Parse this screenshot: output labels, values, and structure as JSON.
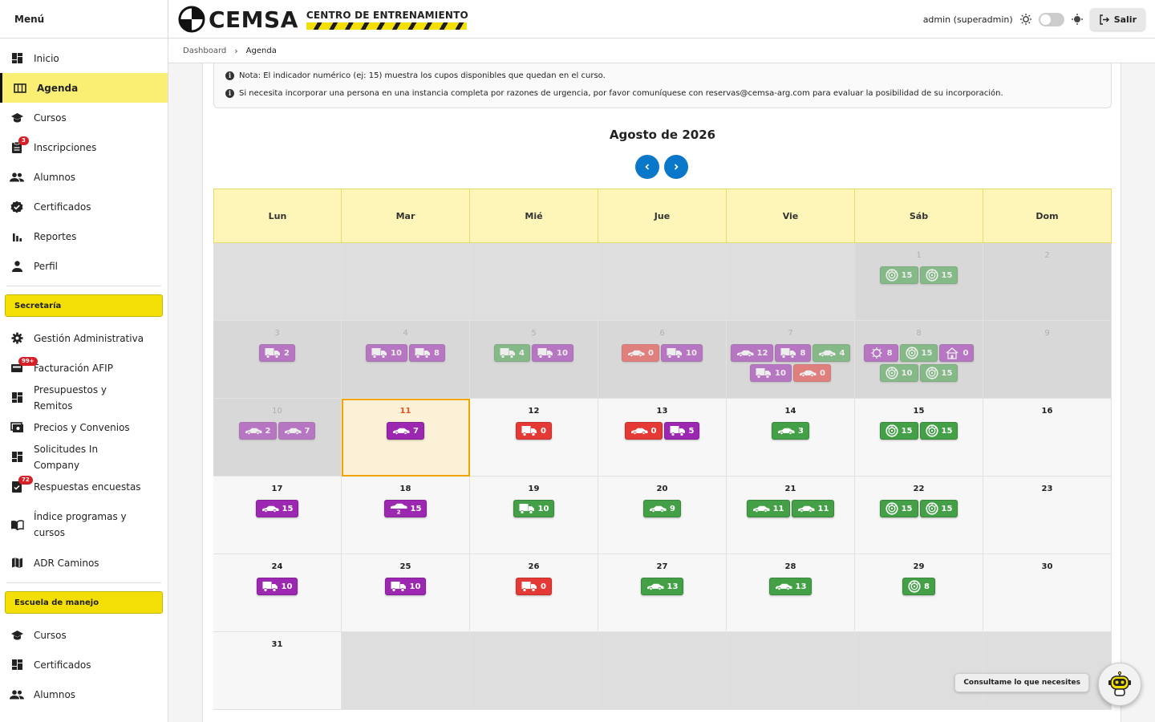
{
  "sidebar": {
    "title": "Menú",
    "items": [
      {
        "label": "Inicio",
        "icon": "dashboard-icon"
      },
      {
        "label": "Agenda",
        "icon": "calendar-icon",
        "active": true
      },
      {
        "label": "Cursos",
        "icon": "school-icon"
      },
      {
        "label": "Inscripciones",
        "icon": "clipboard-icon",
        "badge": "3"
      },
      {
        "label": "Alumnos",
        "icon": "people-icon"
      },
      {
        "label": "Certificados",
        "icon": "verified-icon"
      },
      {
        "label": "Reportes",
        "icon": "bar-chart-icon"
      },
      {
        "label": "Perfil",
        "icon": "person-icon"
      }
    ],
    "section1": "Secretaría",
    "section1_items": [
      {
        "label": "Gestión Administrativa",
        "icon": "gear-icon"
      },
      {
        "label": "Facturación AFIP",
        "icon": "invoice-icon",
        "badge": "99+"
      },
      {
        "label": "Presupuestos y Remitos",
        "icon": "dashboard-icon"
      },
      {
        "label": "Precios y Convenios",
        "icon": "price-icon"
      },
      {
        "label": "Solicitudes In Company",
        "icon": "dashboard-icon"
      },
      {
        "label": "Respuestas encuestas",
        "icon": "survey-icon",
        "badge": "72"
      },
      {
        "label": "Índice programas y cursos",
        "icon": "book-icon"
      },
      {
        "label": "ADR Caminos",
        "icon": "map-icon"
      }
    ],
    "section2": "Escuela de manejo",
    "section2_items": [
      {
        "label": "Cursos",
        "icon": "school-icon"
      },
      {
        "label": "Certificados",
        "icon": "dashboard-icon"
      },
      {
        "label": "Alumnos",
        "icon": "people-icon"
      }
    ]
  },
  "header": {
    "logo_name": "CEMSA",
    "logo_sub": "CENTRO DE ENTRENAMIENTO",
    "user": "admin (superadmin)",
    "logout": "Salir"
  },
  "breadcrumb": {
    "root": "Dashboard",
    "current": "Agenda"
  },
  "notes": [
    "Nota: El indicador numérico (ej: 15) muestra los cupos disponibles que quedan en el curso.",
    "Si necesita incorporar una persona en una instancia completa por razones de urgencia, por favor comuníquese con reservas@cemsa-arg.com para evaluar la posibilidad de su incorporación."
  ],
  "calendar": {
    "title": "Agosto de 2026",
    "weekdays": [
      "Lun",
      "Mar",
      "Mié",
      "Jue",
      "Vie",
      "Sáb",
      "Dom"
    ],
    "colors": {
      "green": "#43a047",
      "purple": "#9c27b0",
      "red": "#e53935",
      "yellow": "#fdf6b8",
      "accent": "#0a78c8"
    },
    "weeks": [
      [
        {
          "blank": true
        },
        {
          "blank": true
        },
        {
          "blank": true
        },
        {
          "blank": true
        },
        {
          "blank": true
        },
        {
          "day": "1",
          "past": true,
          "events": [
            {
              "icon": "tire",
              "color": "green",
              "n": "15"
            },
            {
              "icon": "tire",
              "color": "green",
              "n": "15"
            }
          ]
        },
        {
          "day": "2",
          "past": true,
          "events": []
        }
      ],
      [
        {
          "day": "3",
          "past": true,
          "events": [
            {
              "icon": "truck",
              "color": "purple",
              "n": "2"
            }
          ]
        },
        {
          "day": "4",
          "past": true,
          "events": [
            {
              "icon": "truck",
              "color": "purple",
              "n": "10"
            },
            {
              "icon": "truck",
              "color": "purple",
              "n": "8"
            }
          ]
        },
        {
          "day": "5",
          "past": true,
          "events": [
            {
              "icon": "truck",
              "color": "green",
              "n": "4"
            },
            {
              "icon": "truck",
              "color": "purple",
              "n": "10"
            }
          ]
        },
        {
          "day": "6",
          "past": true,
          "events": [
            {
              "icon": "car",
              "color": "red",
              "n": "0"
            },
            {
              "icon": "truck",
              "color": "purple",
              "n": "10"
            }
          ]
        },
        {
          "day": "7",
          "past": true,
          "events": [
            {
              "icon": "car",
              "color": "purple",
              "n": "12"
            },
            {
              "icon": "truck",
              "color": "purple",
              "n": "8"
            },
            {
              "icon": "car",
              "color": "green",
              "n": "4"
            },
            {
              "icon": "truck",
              "color": "purple",
              "n": "10"
            },
            {
              "icon": "car",
              "color": "red",
              "n": "0"
            }
          ]
        },
        {
          "day": "8",
          "past": true,
          "events": [
            {
              "icon": "virus",
              "color": "purple",
              "n": "8"
            },
            {
              "icon": "tire",
              "color": "green",
              "n": "15"
            },
            {
              "icon": "house",
              "color": "purple",
              "n": "0"
            },
            {
              "icon": "tire",
              "color": "green",
              "n": "10"
            },
            {
              "icon": "tire",
              "color": "green",
              "n": "15"
            }
          ]
        },
        {
          "day": "9",
          "past": true,
          "events": []
        }
      ],
      [
        {
          "day": "10",
          "past": true,
          "events": [
            {
              "icon": "car",
              "color": "purple",
              "n": "2"
            },
            {
              "icon": "car",
              "color": "purple",
              "n": "7"
            }
          ]
        },
        {
          "day": "11",
          "today": true,
          "events": [
            {
              "icon": "car",
              "color": "purple",
              "n": "7"
            }
          ]
        },
        {
          "day": "12",
          "events": [
            {
              "icon": "truck",
              "color": "red",
              "n": "0"
            }
          ]
        },
        {
          "day": "13",
          "events": [
            {
              "icon": "car",
              "color": "red",
              "n": "0"
            },
            {
              "icon": "truck",
              "color": "purple",
              "n": "5"
            }
          ]
        },
        {
          "day": "14",
          "events": [
            {
              "icon": "car",
              "color": "green",
              "n": "3"
            }
          ]
        },
        {
          "day": "15",
          "events": [
            {
              "icon": "tire",
              "color": "green",
              "n": "15"
            },
            {
              "icon": "tire",
              "color": "green",
              "n": "15"
            }
          ]
        },
        {
          "day": "16",
          "events": []
        }
      ],
      [
        {
          "day": "17",
          "events": [
            {
              "icon": "car",
              "color": "purple",
              "n": "15"
            }
          ]
        },
        {
          "day": "18",
          "events": [
            {
              "icon": "car2",
              "color": "purple",
              "n": "15"
            }
          ]
        },
        {
          "day": "19",
          "events": [
            {
              "icon": "truck",
              "color": "green",
              "n": "10"
            }
          ]
        },
        {
          "day": "20",
          "events": [
            {
              "icon": "car",
              "color": "green",
              "n": "9"
            }
          ]
        },
        {
          "day": "21",
          "events": [
            {
              "icon": "car",
              "color": "green",
              "n": "11"
            },
            {
              "icon": "car",
              "color": "green",
              "n": "11"
            }
          ]
        },
        {
          "day": "22",
          "events": [
            {
              "icon": "tire",
              "color": "green",
              "n": "15"
            },
            {
              "icon": "tire",
              "color": "green",
              "n": "15"
            }
          ]
        },
        {
          "day": "23",
          "events": []
        }
      ],
      [
        {
          "day": "24",
          "events": [
            {
              "icon": "truck",
              "color": "purple",
              "n": "10"
            }
          ]
        },
        {
          "day": "25",
          "events": [
            {
              "icon": "truck",
              "color": "purple",
              "n": "10"
            }
          ]
        },
        {
          "day": "26",
          "events": [
            {
              "icon": "truck",
              "color": "red",
              "n": "0"
            }
          ]
        },
        {
          "day": "27",
          "events": [
            {
              "icon": "car",
              "color": "green",
              "n": "13"
            }
          ]
        },
        {
          "day": "28",
          "events": [
            {
              "icon": "car",
              "color": "green",
              "n": "13"
            }
          ]
        },
        {
          "day": "29",
          "events": [
            {
              "icon": "tire",
              "color": "green",
              "n": "8"
            }
          ]
        },
        {
          "day": "30",
          "events": []
        }
      ],
      [
        {
          "day": "31",
          "events": []
        },
        {
          "blank": true
        },
        {
          "blank": true
        },
        {
          "blank": true
        },
        {
          "blank": true
        },
        {
          "blank": true
        },
        {
          "blank": true
        }
      ]
    ]
  },
  "chat": {
    "tooltip": "Consultame lo que necesites"
  }
}
